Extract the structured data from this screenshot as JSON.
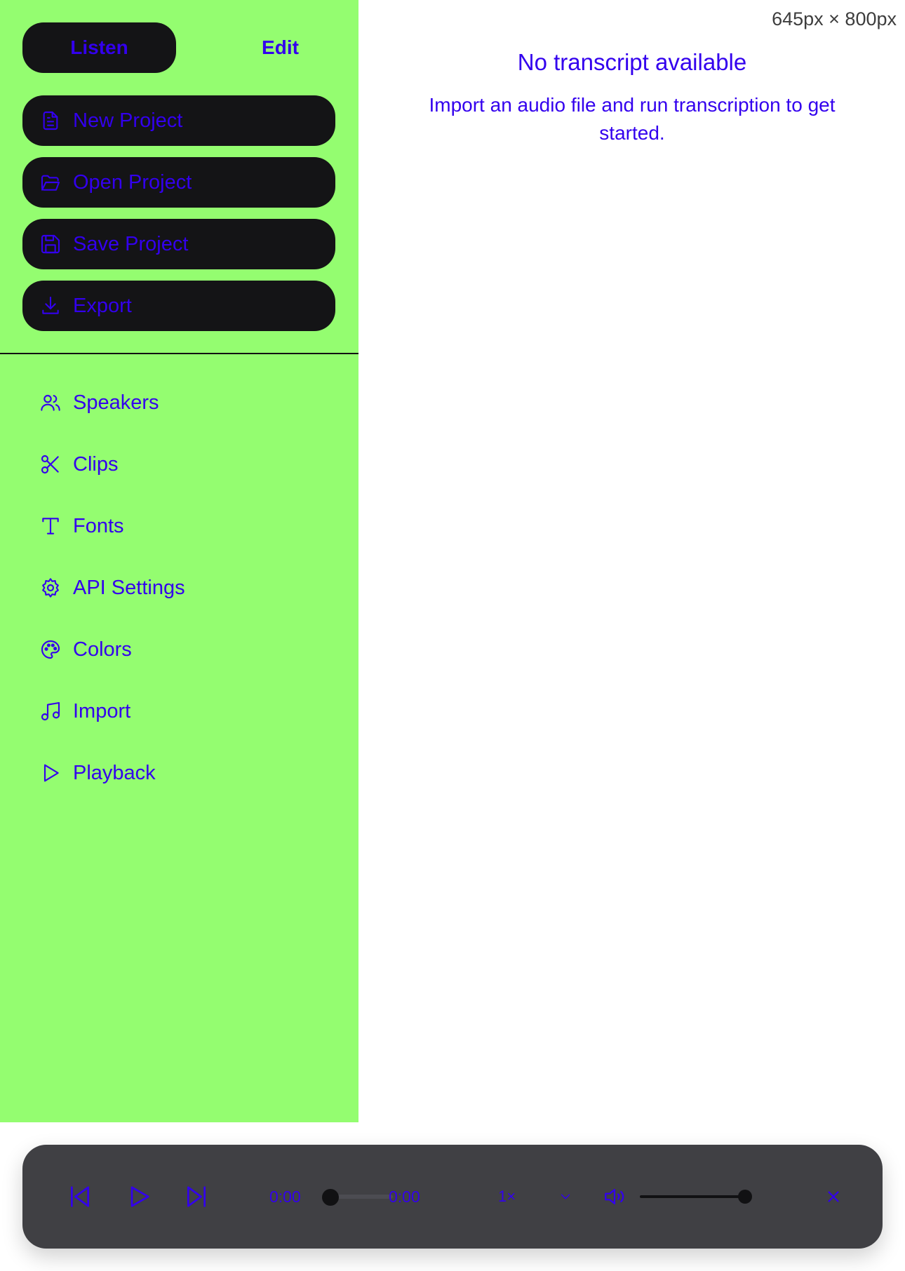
{
  "viewport_label": "645px × 800px",
  "mode_toggle": {
    "listen_label": "Listen",
    "edit_label": "Edit",
    "active": "Listen"
  },
  "actions": [
    {
      "label": "New Project",
      "icon": "file-text-icon"
    },
    {
      "label": "Open Project",
      "icon": "folder-open-icon"
    },
    {
      "label": "Save Project",
      "icon": "save-icon"
    },
    {
      "label": "Export",
      "icon": "download-icon"
    }
  ],
  "nav": [
    {
      "label": "Speakers",
      "icon": "users-icon"
    },
    {
      "label": "Clips",
      "icon": "scissors-icon"
    },
    {
      "label": "Fonts",
      "icon": "type-icon"
    },
    {
      "label": "API Settings",
      "icon": "gear-icon"
    },
    {
      "label": "Colors",
      "icon": "palette-icon"
    },
    {
      "label": "Import",
      "icon": "music-icon"
    },
    {
      "label": "Playback",
      "icon": "play-icon"
    }
  ],
  "main": {
    "empty_title": "No transcript available",
    "empty_description": "Import an audio file and run transcription to get started."
  },
  "player": {
    "current_time": "0:00",
    "duration": "0:00",
    "speed": "1×",
    "progress": 0,
    "volume": 1.0
  },
  "colors": {
    "sidebar_bg": "#94fd70",
    "accent_text": "#3300ee",
    "button_bg": "#141416",
    "player_bg": "#404044"
  }
}
